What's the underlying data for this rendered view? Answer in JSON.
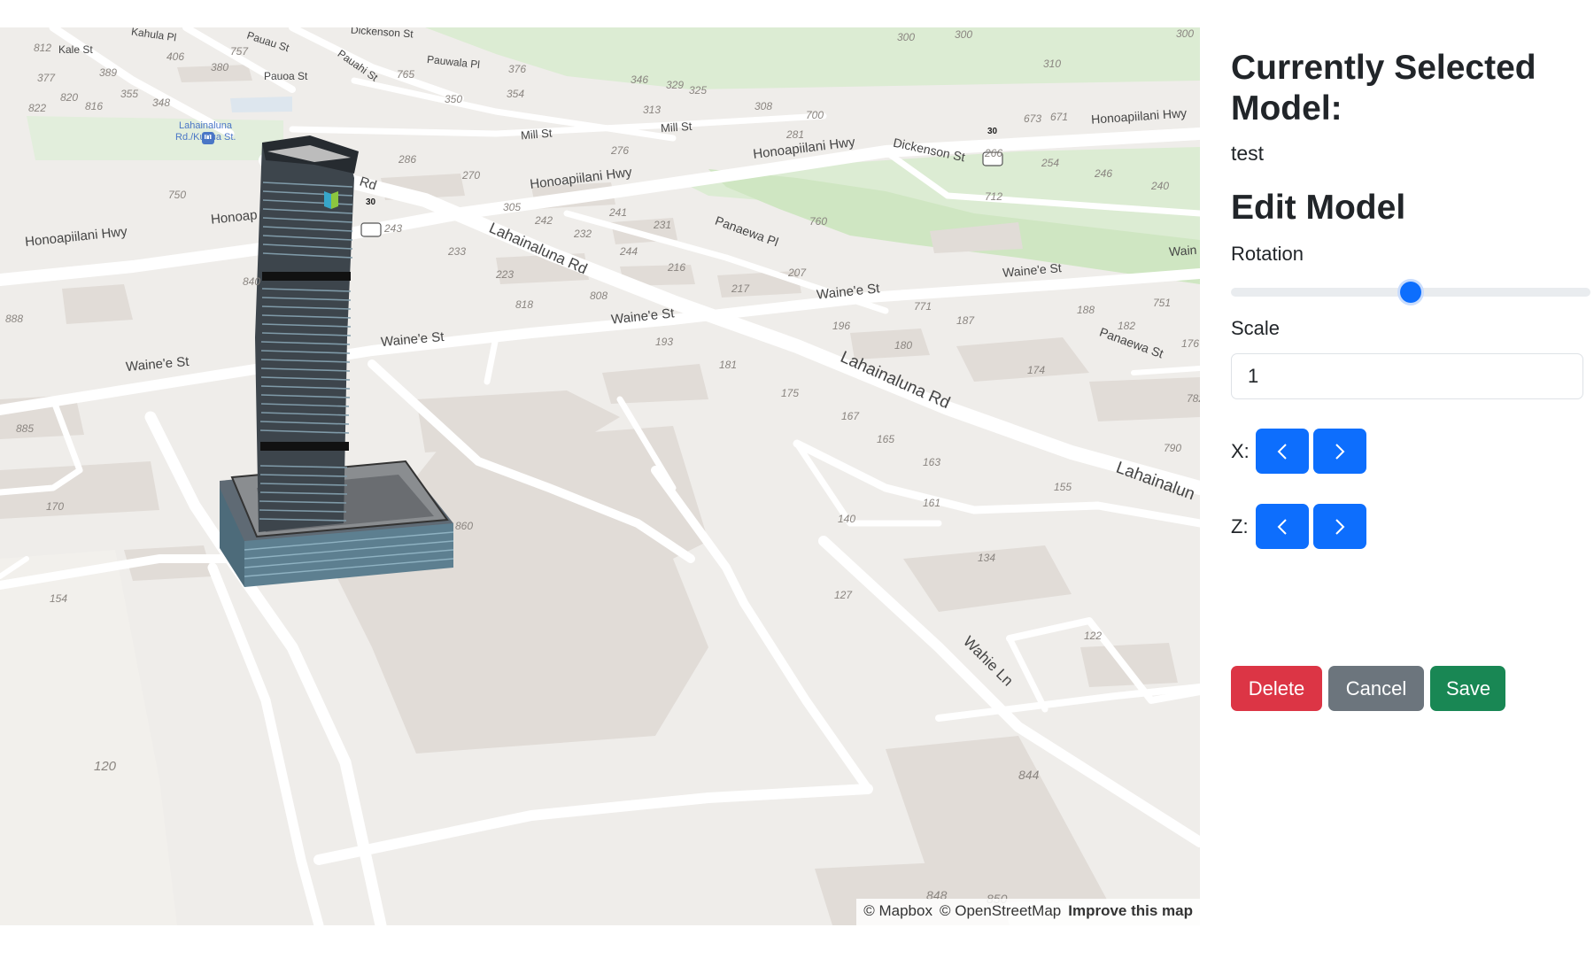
{
  "map": {
    "attribution": {
      "mapbox": "© Mapbox",
      "osm": "© OpenStreetMap",
      "improve": "Improve this map"
    },
    "street_labels": [
      "Kahula Pl",
      "Kale St",
      "Pauau St",
      "Pauoa St",
      "Pauahi St",
      "Dickenson St",
      "Pauwala Pl",
      "Mill St",
      "Mill St",
      "Honoapiilani Hwy",
      "Honoapiilani Hwy",
      "Dickenson St",
      "Honoapiilani Hwy",
      "Honoapiilani Hwy",
      "Honoap",
      "Rd",
      "Lahainaluna Rd",
      "Panaewa Pl",
      "Waine'e St",
      "Waine'e St",
      "Waine'e St",
      "Waine'e St",
      "Waine'e St",
      "Panaewa St",
      "Lahainaluna Rd",
      "Lahainalun",
      "Wahie Ln",
      "Wain"
    ],
    "poi": {
      "name_line1": "Lahainaluna",
      "name_line2": "Rd./Kuhua St.",
      "icon": "bus-stop-icon"
    },
    "route_shields": [
      "30",
      "30"
    ],
    "house_numbers": [
      "300",
      "300",
      "300",
      "310",
      "286",
      "270",
      "276",
      "305",
      "242",
      "232",
      "241",
      "231",
      "244",
      "233",
      "243",
      "840",
      "223",
      "818",
      "808",
      "216",
      "217",
      "207",
      "760",
      "771",
      "187",
      "188",
      "751",
      "182",
      "176",
      "196",
      "180",
      "174",
      "193",
      "181",
      "175",
      "167",
      "165",
      "163",
      "161",
      "155",
      "140",
      "134",
      "127",
      "122",
      "790",
      "782",
      "888",
      "885",
      "170",
      "154",
      "120",
      "860",
      "844",
      "848",
      "850",
      "712",
      "673",
      "671",
      "266",
      "254",
      "246",
      "240",
      "313",
      "308",
      "281",
      "700",
      "346",
      "329",
      "325",
      "350",
      "354",
      "376",
      "377",
      "389",
      "355",
      "348",
      "380",
      "406",
      "757",
      "765",
      "812",
      "822",
      "820",
      "816",
      "750"
    ],
    "model_logo_color": "#37a6c9"
  },
  "panel": {
    "selected_heading": "Currently Selected Model:",
    "selected_value": "test",
    "edit_heading": "Edit Model",
    "rotation_label": "Rotation",
    "rotation_fraction": 0.5,
    "scale_label": "Scale",
    "scale_value": "1",
    "x_label": "X:",
    "z_label": "Z:",
    "x_left_icon": "chevron-left-icon",
    "x_right_icon": "chevron-right-icon",
    "z_left_icon": "chevron-left-icon",
    "z_right_icon": "chevron-right-icon",
    "delete_label": "Delete",
    "cancel_label": "Cancel",
    "save_label": "Save"
  },
  "colors": {
    "primary": "#0d6efd",
    "danger": "#dc3545",
    "secondary": "#6c757d",
    "success": "#198754",
    "map_land": "#efedea",
    "map_park": "#d9ebcf",
    "map_road": "#ffffff",
    "map_building": "#e0dbd6"
  }
}
